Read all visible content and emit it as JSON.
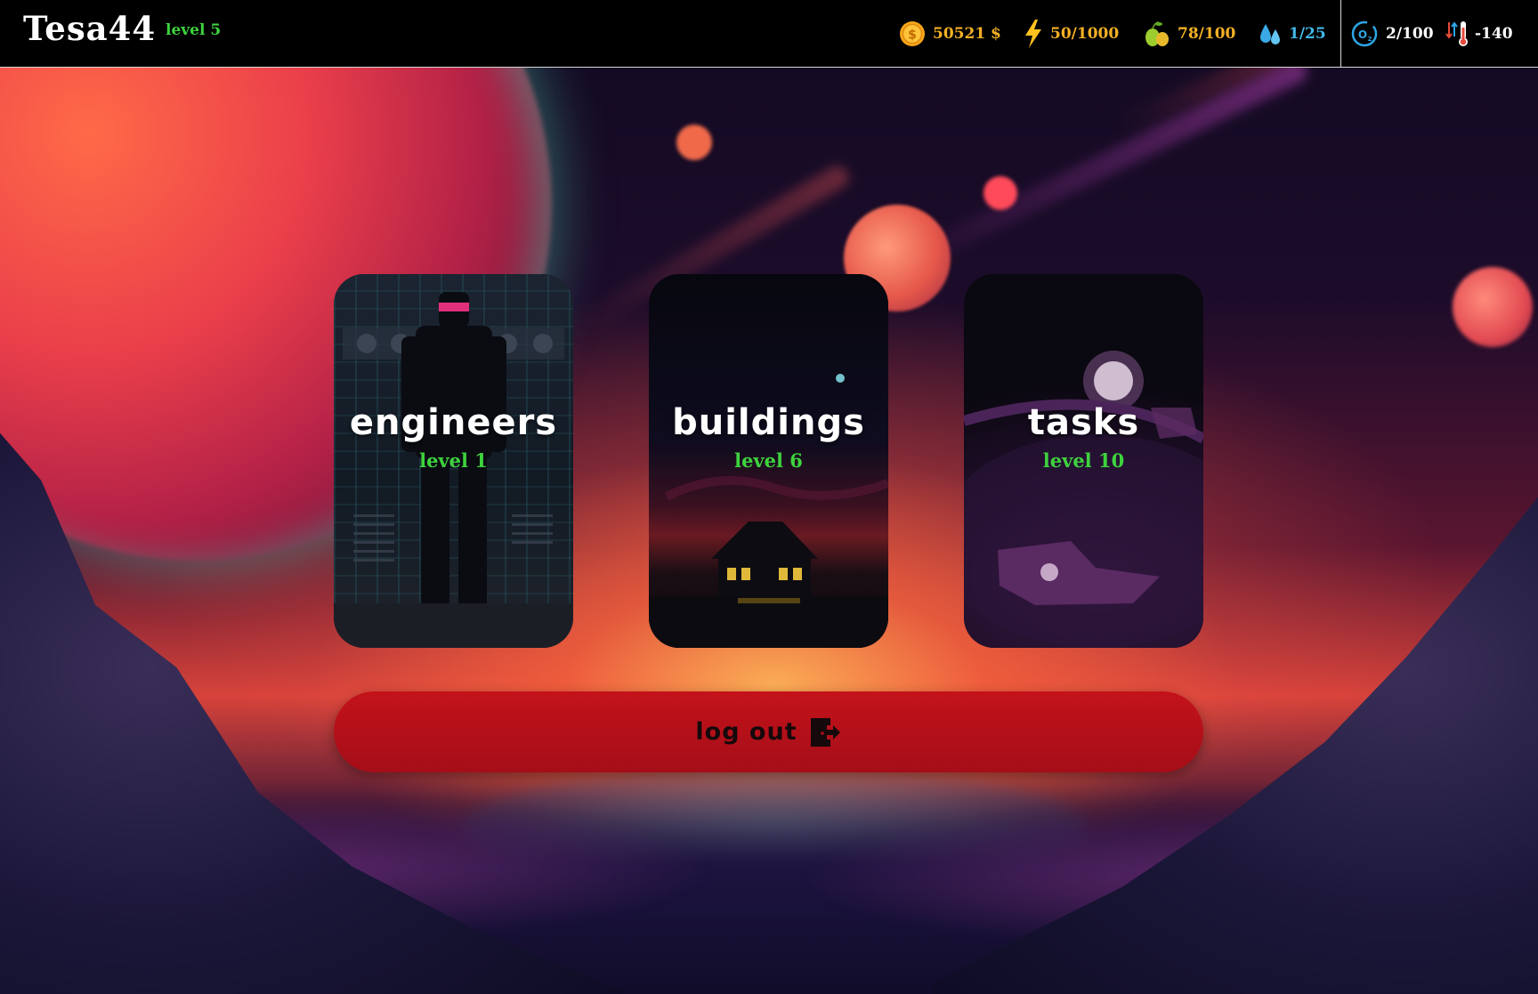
{
  "player": {
    "name": "Tesa44",
    "level": "level 5"
  },
  "stats": {
    "money": {
      "value": "50521 $",
      "icon": "coin-icon",
      "color": "#f2b024"
    },
    "energy": {
      "value": "50/1000",
      "icon": "lightning-icon",
      "color": "#f2b024"
    },
    "food": {
      "value": "78/100",
      "icon": "fruit-icon",
      "color": "#f2b024"
    },
    "water": {
      "value": "1/25",
      "icon": "water-drop-icon",
      "color": "#41b8e8"
    },
    "oxygen": {
      "value": "2/100",
      "icon": "oxygen-icon",
      "color": "#ffffff"
    },
    "temperature": {
      "value": "-140",
      "icon": "thermometer-icon",
      "color": "#ffffff"
    }
  },
  "cards": [
    {
      "title": "engineers",
      "level": "level 1"
    },
    {
      "title": "buildings",
      "level": "level 6"
    },
    {
      "title": "tasks",
      "level": "level 10"
    }
  ],
  "logout": {
    "label": "log out",
    "icon": "door-exit-icon"
  },
  "colors": {
    "level_green": "#3ed23e",
    "logout_red": "#b0101a",
    "stat_gold": "#f2b024",
    "water_blue": "#41b8e8"
  }
}
